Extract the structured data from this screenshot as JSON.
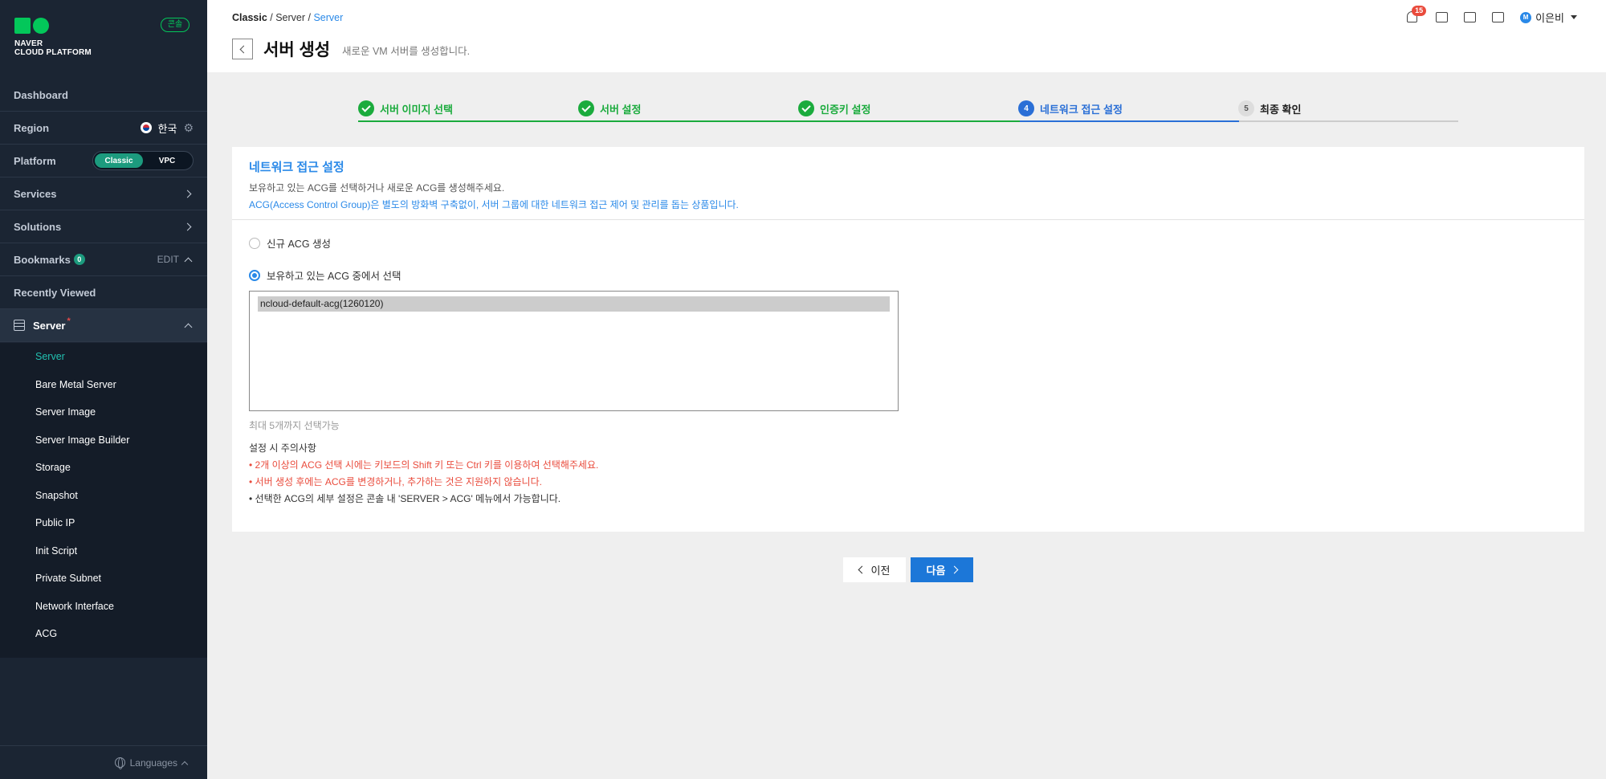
{
  "sidebar": {
    "logo_line1": "NAVER",
    "logo_line2": "CLOUD PLATFORM",
    "console_badge": "콘솔",
    "dashboard": "Dashboard",
    "region_label": "Region",
    "region_value": "한국",
    "platform_label": "Platform",
    "platform_options": [
      "Classic",
      "VPC"
    ],
    "platform_selected": "Classic",
    "services": "Services",
    "solutions": "Solutions",
    "bookmarks": "Bookmarks",
    "bookmarks_count": "0",
    "bookmarks_edit": "EDIT",
    "recently_viewed": "Recently Viewed",
    "server_group": "Server",
    "server_group_marker": "*",
    "submenu": [
      "Server",
      "Bare Metal Server",
      "Server Image",
      "Server Image Builder",
      "Storage",
      "Snapshot",
      "Public IP",
      "Init Script",
      "Private Subnet",
      "Network Interface",
      "ACG"
    ],
    "submenu_active": "Server",
    "languages": "Languages"
  },
  "header": {
    "breadcrumb": [
      "Classic",
      "Server",
      "Server"
    ],
    "title": "서버 생성",
    "subtitle": "새로운 VM 서버를 생성합니다.",
    "notification_count": "15",
    "user_initial": "M",
    "user_name": "이은비"
  },
  "stepper": {
    "steps": [
      {
        "num": "1",
        "label": "서버 이미지 선택",
        "state": "done"
      },
      {
        "num": "2",
        "label": "서버 설정",
        "state": "done"
      },
      {
        "num": "3",
        "label": "인증키 설정",
        "state": "done"
      },
      {
        "num": "4",
        "label": "네트워크 접근 설정",
        "state": "current"
      },
      {
        "num": "5",
        "label": "최종 확인",
        "state": "todo"
      }
    ]
  },
  "card": {
    "title": "네트워크 접근 설정",
    "desc1": "보유하고 있는 ACG를 선택하거나 새로운 ACG를 생성해주세요.",
    "desc2": "ACG(Access Control Group)은 별도의 방화벽 구축없이, 서버 그룹에 대한 네트워크 접근 제어 및 관리를 돕는 상품입니다.",
    "radio_new": "신규 ACG 생성",
    "radio_existing": "보유하고 있는 ACG 중에서 선택",
    "radio_selected": "existing",
    "acg_options": [
      "ncloud-default-acg(1260120)"
    ],
    "acg_selected": "ncloud-default-acg(1260120)",
    "limit_hint": "최대 5개까지 선택가능",
    "notes_title": "설정 시 주의사항",
    "note1": "• 2개 이상의 ACG 선택 시에는 키보드의 Shift 키 또는 Ctrl 키를 이용하여 선택해주세요.",
    "note2": "• 서버 생성 후에는 ACG를 변경하거나, 추가하는 것은 지원하지 않습니다.",
    "note3": "• 선택한 ACG의 세부 설정은 콘솔 내 'SERVER > ACG' 메뉴에서 가능합니다."
  },
  "buttons": {
    "prev": "이전",
    "next": "다음"
  },
  "colors": {
    "sidebar_bg": "#1b2533",
    "accent_blue": "#2a89e8",
    "success_green": "#1bab3d",
    "primary_button": "#1c77d8",
    "warning_red": "#e94b3c"
  }
}
